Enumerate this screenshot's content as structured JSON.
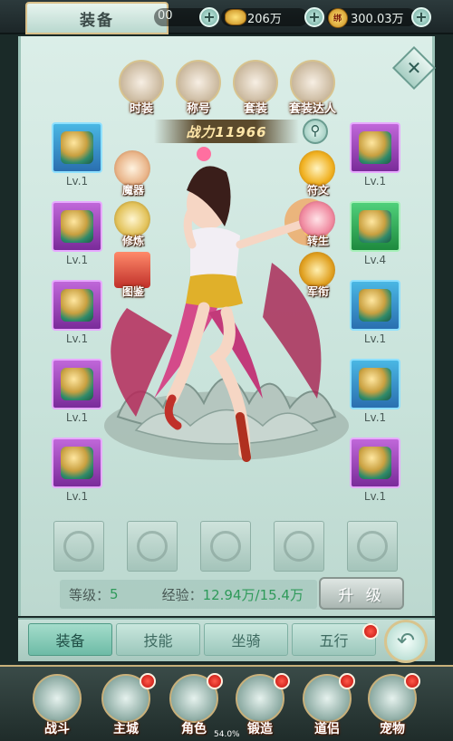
{
  "header": {
    "title": "装备",
    "currency1": "00",
    "currency2": "206万",
    "currency3": "300.03万",
    "bind_label": "绑"
  },
  "top_icons": [
    {
      "label": "时装",
      "name": "fashion"
    },
    {
      "label": "称号",
      "name": "title"
    },
    {
      "label": "套装",
      "name": "suit"
    },
    {
      "label": "套装达人",
      "name": "suit-master"
    }
  ],
  "power": "战力11966",
  "left_slots": [
    {
      "level": "Lv.1",
      "color": "blue"
    },
    {
      "level": "Lv.1",
      "color": "purple"
    },
    {
      "level": "Lv.1",
      "color": "purple"
    },
    {
      "level": "Lv.1",
      "color": "purple"
    },
    {
      "level": "Lv.1",
      "color": "purple"
    }
  ],
  "right_slots": [
    {
      "level": "Lv.1",
      "color": "purple"
    },
    {
      "level": "Lv.4",
      "color": "green"
    },
    {
      "level": "Lv.1",
      "color": "blue"
    },
    {
      "level": "Lv.1",
      "color": "blue"
    },
    {
      "level": "Lv.1",
      "color": "purple"
    }
  ],
  "left_buttons": [
    "魔器",
    "修炼",
    "图鉴"
  ],
  "right_buttons": [
    "符文",
    "转生",
    "军衔"
  ],
  "stats": {
    "level_label": "等级：",
    "level_value": "5",
    "exp_label": "经验：",
    "exp_value": "12.94万/15.4万"
  },
  "upgrade_label": "升 级",
  "tabs": [
    "装备",
    "技能",
    "坐骑",
    "五行"
  ],
  "bottom_nav": [
    "战斗",
    "主城",
    "角色",
    "锻造",
    "道侣",
    "宠物"
  ],
  "progress_text": "54.0%",
  "colors": {
    "slot_blue": "#2a6fb0",
    "slot_purple": "#7a2b9a",
    "slot_green": "#1e8a3e",
    "panel": "#c9e3db",
    "level_green": "#2f9a5a"
  }
}
